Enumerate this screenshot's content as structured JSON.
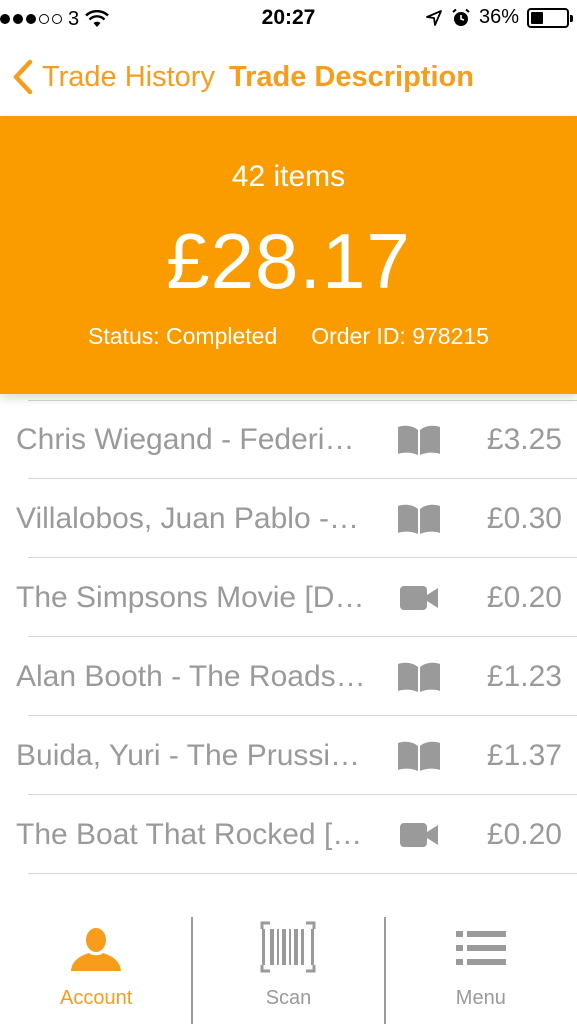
{
  "status_bar": {
    "carrier": "3",
    "time": "20:27",
    "battery": "36%",
    "battery_level": 0.36
  },
  "nav": {
    "back_label": "Trade History",
    "title": "Trade Description"
  },
  "summary": {
    "item_count": "42 items",
    "total": "£28.17",
    "status": "Status: Completed",
    "order_id": "Order ID: 978215"
  },
  "items": [
    {
      "title": "Chris Wiegand - Federi…",
      "icon": "book-icon",
      "price": "£3.25"
    },
    {
      "title": "Villalobos, Juan Pablo -…",
      "icon": "book-icon",
      "price": "£0.30"
    },
    {
      "title": "The Simpsons Movie [D…",
      "icon": "video-camera-icon",
      "price": "£0.20"
    },
    {
      "title": "Alan Booth - The Roads…",
      "icon": "book-icon",
      "price": "£1.23"
    },
    {
      "title": "Buida, Yuri - The Prussi…",
      "icon": "book-icon",
      "price": "£1.37"
    },
    {
      "title": "The Boat That Rocked […",
      "icon": "video-camera-icon",
      "price": "£0.20"
    }
  ],
  "tabs": [
    {
      "label": "Account",
      "icon": "person-icon",
      "active": true
    },
    {
      "label": "Scan",
      "icon": "barcode-icon",
      "active": false
    },
    {
      "label": "Menu",
      "icon": "list-icon",
      "active": false
    }
  ],
  "colors": {
    "accent": "#fa9c00",
    "text_muted": "#9a9a9a"
  }
}
